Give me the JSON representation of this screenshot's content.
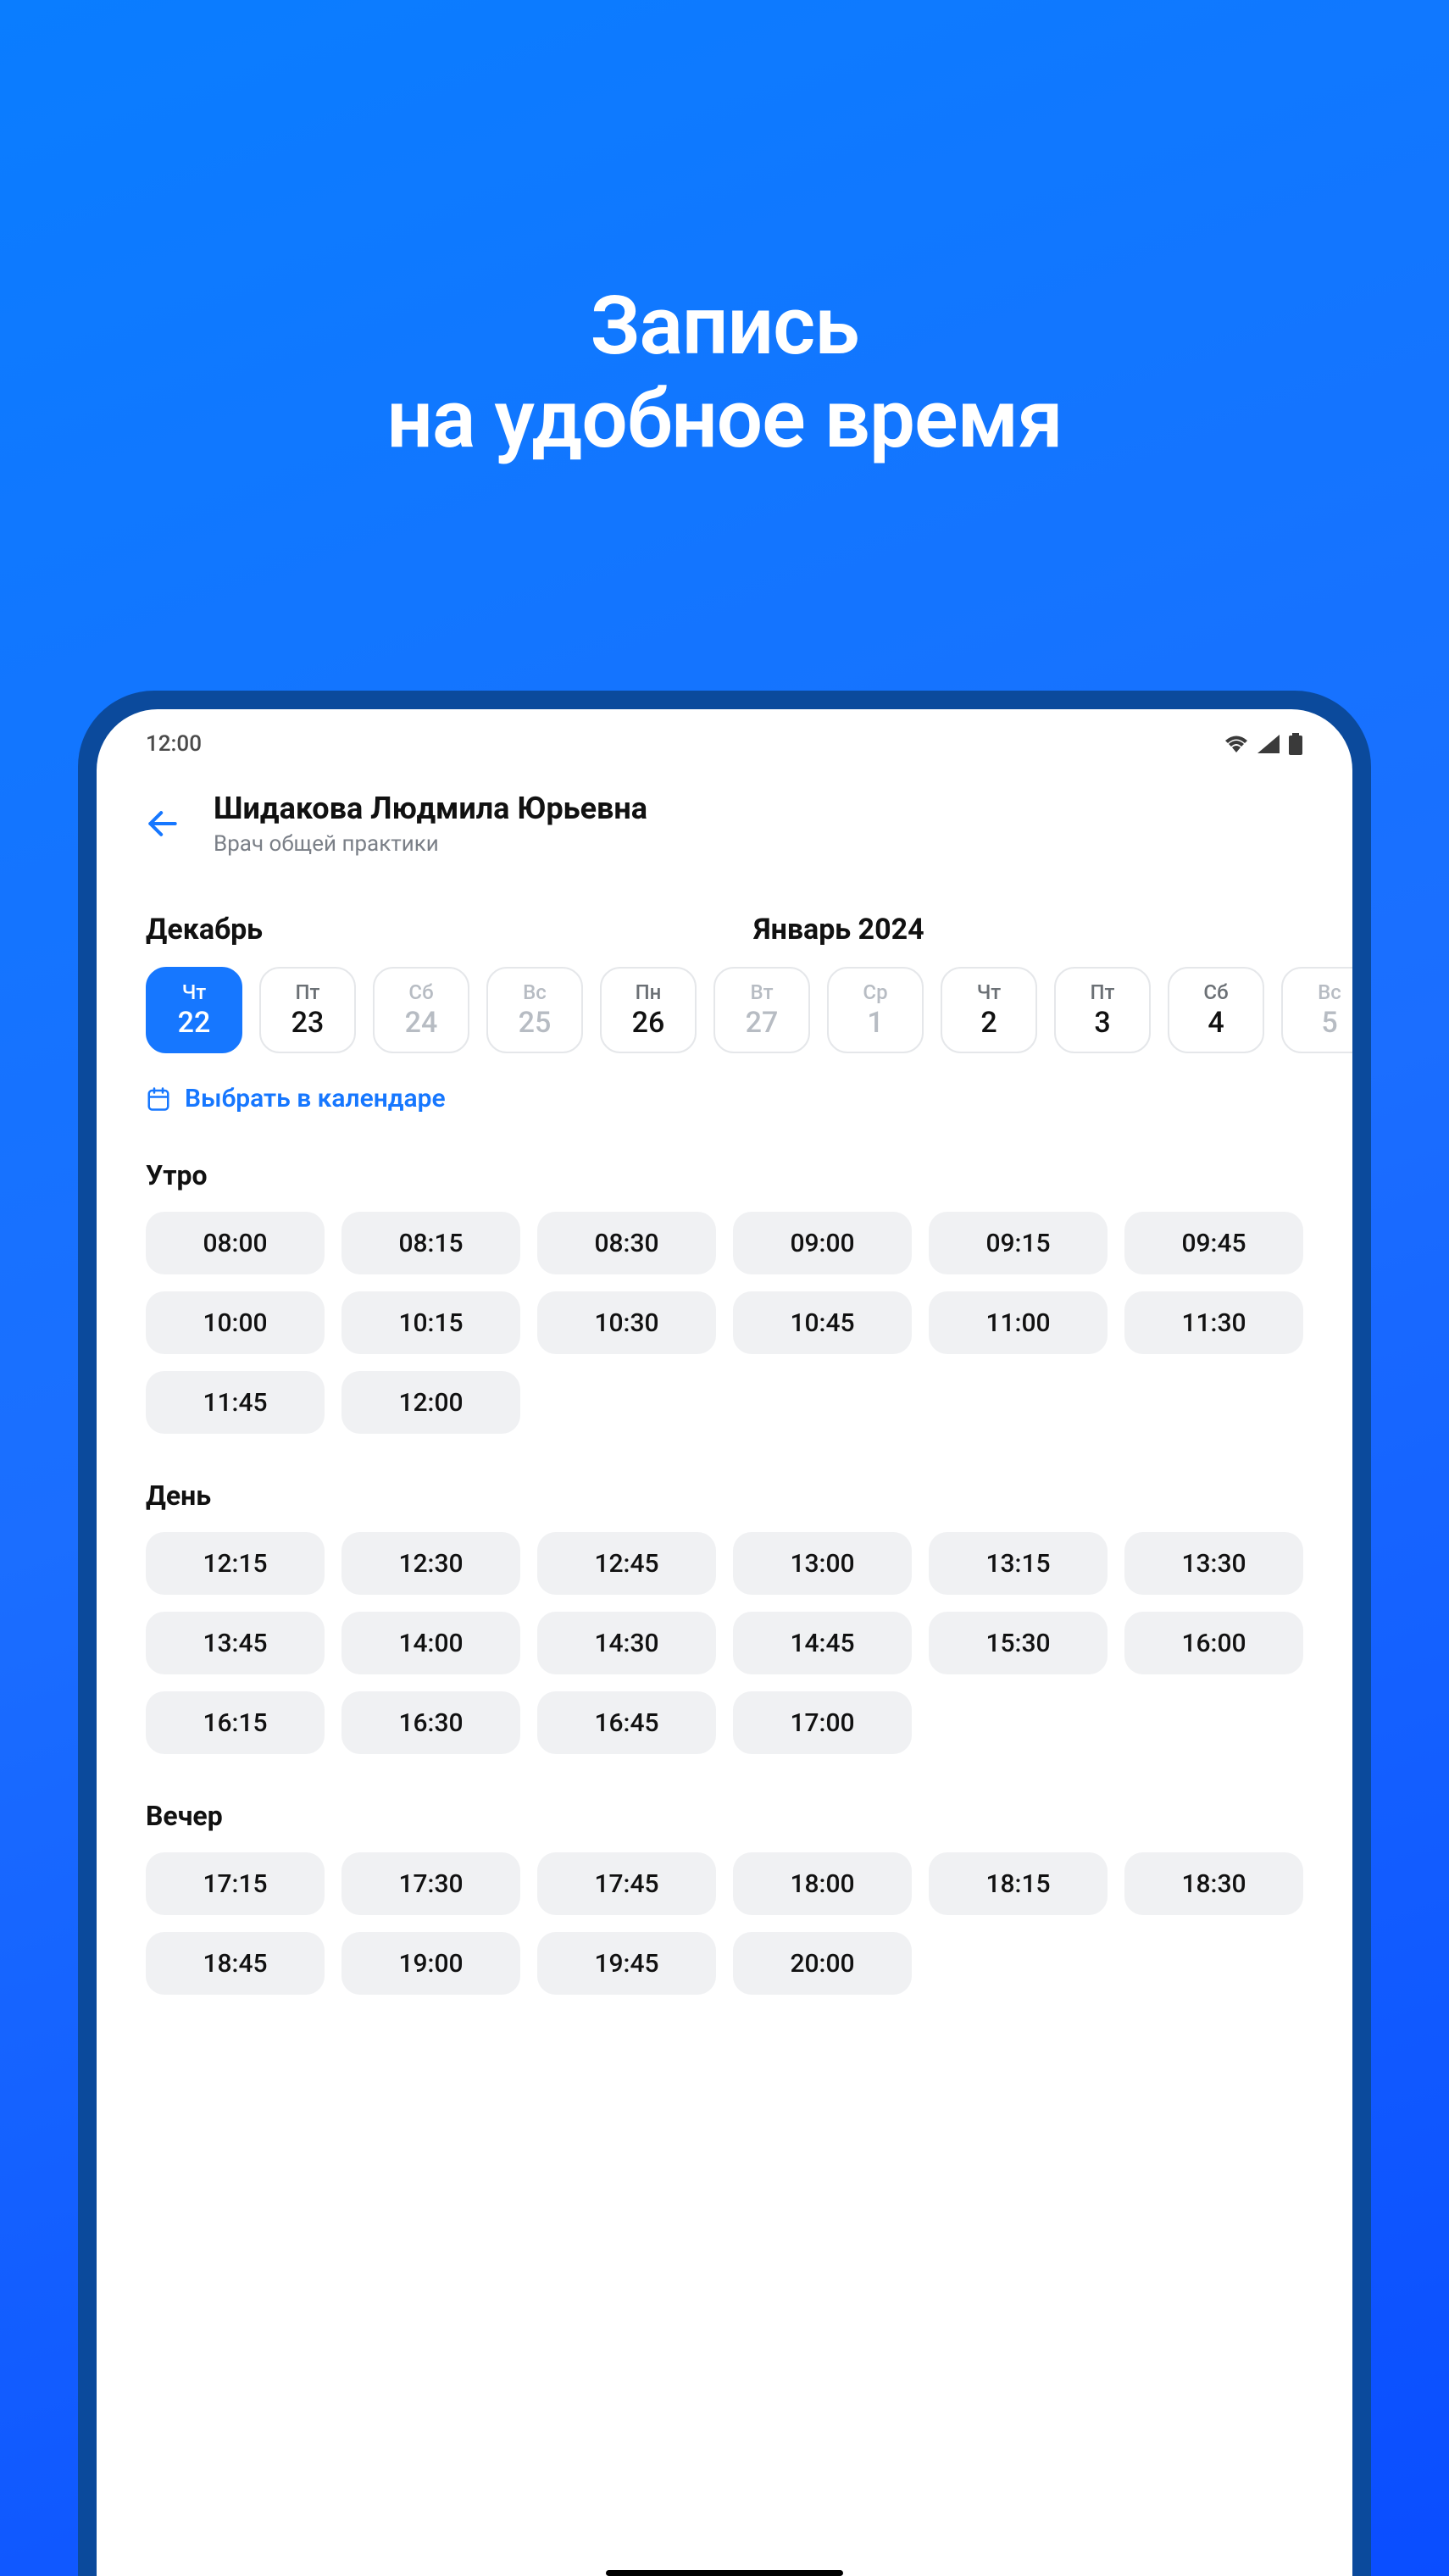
{
  "hero": {
    "line1": "Запись",
    "line2": "на удобное время"
  },
  "status": {
    "time": "12:00"
  },
  "doctor": {
    "name": "Шидакова Людмила Юрьевна",
    "spec": "Врач общей практики"
  },
  "months": {
    "left": "Декабрь",
    "right": "Январь 2024"
  },
  "dates": [
    {
      "dow": "Чт",
      "num": "22",
      "state": "selected"
    },
    {
      "dow": "Пт",
      "num": "23",
      "state": "normal"
    },
    {
      "dow": "Сб",
      "num": "24",
      "state": "disabled"
    },
    {
      "dow": "Вс",
      "num": "25",
      "state": "disabled"
    },
    {
      "dow": "Пн",
      "num": "26",
      "state": "normal"
    },
    {
      "dow": "Вт",
      "num": "27",
      "state": "disabled"
    },
    {
      "dow": "Ср",
      "num": "1",
      "state": "disabled"
    },
    {
      "dow": "Чт",
      "num": "2",
      "state": "normal"
    },
    {
      "dow": "Пт",
      "num": "3",
      "state": "normal"
    },
    {
      "dow": "Сб",
      "num": "4",
      "state": "normal"
    },
    {
      "dow": "Вс",
      "num": "5",
      "state": "disabled"
    }
  ],
  "calendar_link": "Выбрать в календаре",
  "sections": [
    {
      "title": "Утро",
      "slots": [
        "08:00",
        "08:15",
        "08:30",
        "09:00",
        "09:15",
        "09:45",
        "10:00",
        "10:15",
        "10:30",
        "10:45",
        "11:00",
        "11:30",
        "11:45",
        "12:00"
      ]
    },
    {
      "title": "День",
      "slots": [
        "12:15",
        "12:30",
        "12:45",
        "13:00",
        "13:15",
        "13:30",
        "13:45",
        "14:00",
        "14:30",
        "14:45",
        "15:30",
        "16:00",
        "16:15",
        "16:30",
        "16:45",
        "17:00"
      ]
    },
    {
      "title": "Вечер",
      "slots": [
        "17:15",
        "17:30",
        "17:45",
        "18:00",
        "18:15",
        "18:30",
        "18:45",
        "19:00",
        "19:45",
        "20:00"
      ]
    }
  ]
}
